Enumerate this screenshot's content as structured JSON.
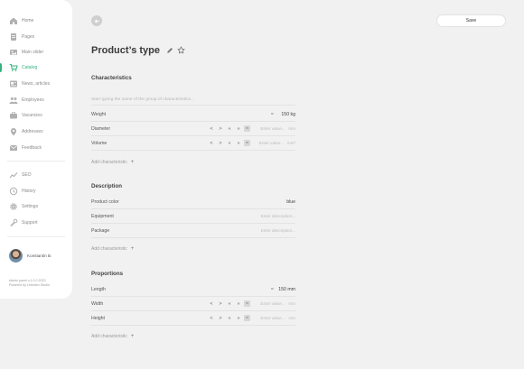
{
  "sidebar": {
    "items": [
      {
        "label": "Home",
        "icon": "home-icon"
      },
      {
        "label": "Pages",
        "icon": "pages-icon"
      },
      {
        "label": "Main slider",
        "icon": "slider-icon"
      },
      {
        "label": "Catalog",
        "icon": "cart-icon",
        "active": true
      },
      {
        "label": "News, articles",
        "icon": "news-icon"
      },
      {
        "label": "Employees",
        "icon": "people-icon"
      },
      {
        "label": "Vacancies",
        "icon": "briefcase-icon"
      },
      {
        "label": "Addresses",
        "icon": "pin-icon"
      },
      {
        "label": "Feedback",
        "icon": "mail-icon"
      },
      {
        "label": "SEO",
        "icon": "chart-icon"
      },
      {
        "label": "History",
        "icon": "history-icon"
      },
      {
        "label": "Settings",
        "icon": "gear-icon"
      },
      {
        "label": "Support",
        "icon": "wrench-icon"
      }
    ],
    "user_name": "Konstantin B.",
    "version": "Admin panel v.1.0.0 2023",
    "powered": "Powered by Lebedev Studio",
    "accent": "#35b27d"
  },
  "header": {
    "save_label": "Save",
    "title": "Product’s type"
  },
  "sections": {
    "characteristics": {
      "title": "Characteristics",
      "search_placeholder": "Start typing the name of the group of characteristics...",
      "rows": [
        {
          "label": "Weight",
          "value": "150 kg"
        },
        {
          "label": "Diameter",
          "placeholder": "Enter value...",
          "unit": "mm"
        },
        {
          "label": "Volume",
          "placeholder": "Enter value...",
          "unit": "mm³"
        }
      ],
      "add_label": "Add characteristic"
    },
    "description": {
      "title": "Description",
      "rows": [
        {
          "label": "Product color",
          "value": "blue"
        },
        {
          "label": "Equipment",
          "placeholder": "Enter description..."
        },
        {
          "label": "Package",
          "placeholder": "Enter description..."
        }
      ],
      "add_label": "Add characteristic"
    },
    "proportions": {
      "title": "Proportions",
      "rows": [
        {
          "label": "Length",
          "value": "150 mm"
        },
        {
          "label": "Width",
          "placeholder": "Enter value...",
          "unit": "mm"
        },
        {
          "label": "Height",
          "placeholder": "Enter value...",
          "unit": "mm"
        }
      ],
      "add_label": "Add characteristic"
    }
  },
  "controls": {
    "prev": "<",
    "next": ">",
    "first": "«",
    "last": "»",
    "box": "m"
  },
  "eq_symbol": "=",
  "plus": "+"
}
